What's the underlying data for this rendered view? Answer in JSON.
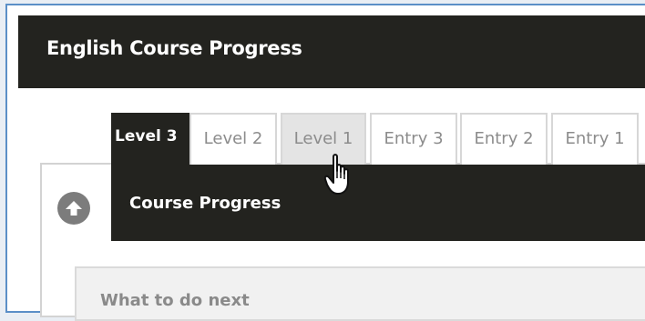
{
  "header": {
    "title": "English Course Progress"
  },
  "tabs": [
    {
      "label": "Level 3",
      "state": "active"
    },
    {
      "label": "Level 2",
      "state": "normal"
    },
    {
      "label": "Level 1",
      "state": "hover"
    },
    {
      "label": "Entry 3",
      "state": "normal"
    },
    {
      "label": "Entry 2",
      "state": "normal"
    },
    {
      "label": "Entry 1",
      "state": "normal"
    }
  ],
  "panel": {
    "title": "Course Progress",
    "up_icon": "arrow-up-circle-icon"
  },
  "next": {
    "label": "What to do next"
  },
  "cursor": {
    "icon": "hand-pointer-icon"
  },
  "colors": {
    "header_bg": "#23231f",
    "frame_border": "#5b8fc7",
    "tab_border": "#d7d7d7",
    "tab_text": "#8c8c8c",
    "tab_hover_bg": "#e4e4e4",
    "icon_grey": "#7c7c7c"
  }
}
